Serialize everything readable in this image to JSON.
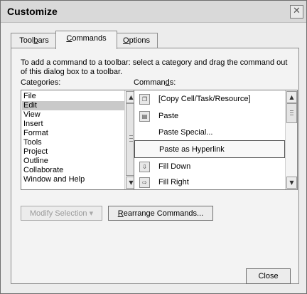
{
  "window": {
    "title": "Customize",
    "close_glyph": "✕"
  },
  "tabs": [
    {
      "pre": "Tool",
      "ul": "b",
      "post": "ars"
    },
    {
      "pre": "",
      "ul": "C",
      "post": "ommands"
    },
    {
      "pre": "",
      "ul": "O",
      "post": "ptions"
    }
  ],
  "panel": {
    "instruction": "To add a command to a toolbar: select a category and drag the command out of this dialog box to a toolbar.",
    "categories_label": {
      "pre": "Categories:",
      "ul": "",
      "post": ""
    },
    "commands_label": {
      "pre": "Comman",
      "ul": "d",
      "post": "s:"
    },
    "categories": [
      "File",
      "Edit",
      "View",
      "Insert",
      "Format",
      "Tools",
      "Project",
      "Outline",
      "Collaborate",
      "Window and Help"
    ],
    "selected_category": "Edit",
    "commands": [
      {
        "label": "[Copy Cell/Task/Resource]",
        "icon": "copy-icon",
        "glyph": "❐"
      },
      {
        "label": "Paste",
        "icon": "paste-icon",
        "glyph": "▤"
      },
      {
        "label": "Paste Special...",
        "icon": "",
        "glyph": ""
      },
      {
        "label": "Paste as Hyperlink",
        "icon": "",
        "glyph": ""
      },
      {
        "label": "Fill Down",
        "icon": "fill-down-icon",
        "glyph": "⇩"
      },
      {
        "label": "Fill Right",
        "icon": "fill-right-icon",
        "glyph": "⇨"
      }
    ],
    "selected_command": "Paste as Hyperlink",
    "modify_selection": {
      "label": "Modify Selection",
      "arrow": "▾"
    },
    "rearrange": {
      "pre": "",
      "ul": "R",
      "post": "earrange Commands..."
    }
  },
  "footer": {
    "close_label": "Close"
  },
  "scroll_glyphs": {
    "up": "▲",
    "down": "▼"
  }
}
